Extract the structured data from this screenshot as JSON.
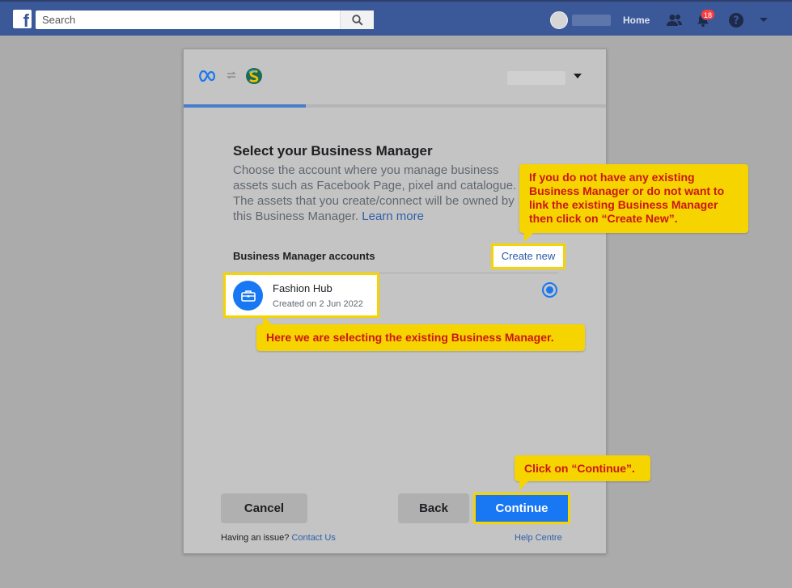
{
  "topbar": {
    "search_placeholder": "Search",
    "home_label": "Home",
    "notification_count": "18",
    "brand_color": "#3b5998",
    "icons": [
      "facebook-logo-icon",
      "search-icon",
      "friends-icon",
      "bell-icon",
      "help-icon",
      "caret-down-icon"
    ]
  },
  "dialog": {
    "header_icons": [
      "meta-logo-icon",
      "swap-icon",
      "app-logo-icon",
      "caret-down-icon"
    ],
    "progress": 0.29,
    "title": "Select your Business Manager",
    "description": "Choose the account where you manage business assets such as Facebook Page, pixel and catalogue. The assets that you create/connect will be owned by this Business Manager.",
    "learn_more": "Learn more",
    "section_label": "Business Manager accounts",
    "create_new": "Create new",
    "account": {
      "name": "Fashion Hub",
      "created": "Created on 2 Jun 2022",
      "icon": "briefcase-icon",
      "selected": true
    },
    "buttons": {
      "cancel": "Cancel",
      "back": "Back",
      "continue": "Continue"
    },
    "footer": {
      "issue_text": "Having an issue?",
      "contact_us": "Contact Us",
      "help_centre": "Help Centre"
    },
    "accent_color": "#1877f2"
  },
  "callouts": {
    "create_new_tip": "If you do not have any existing Business Manager or do not want to link the existing Business Manager then click on “Create New”.",
    "selecting_tip": "Here we are selecting the existing Business Manager.",
    "continue_tip": "Click on “Continue”.",
    "highlight_color": "#f5d400",
    "text_color": "#cc1616"
  }
}
